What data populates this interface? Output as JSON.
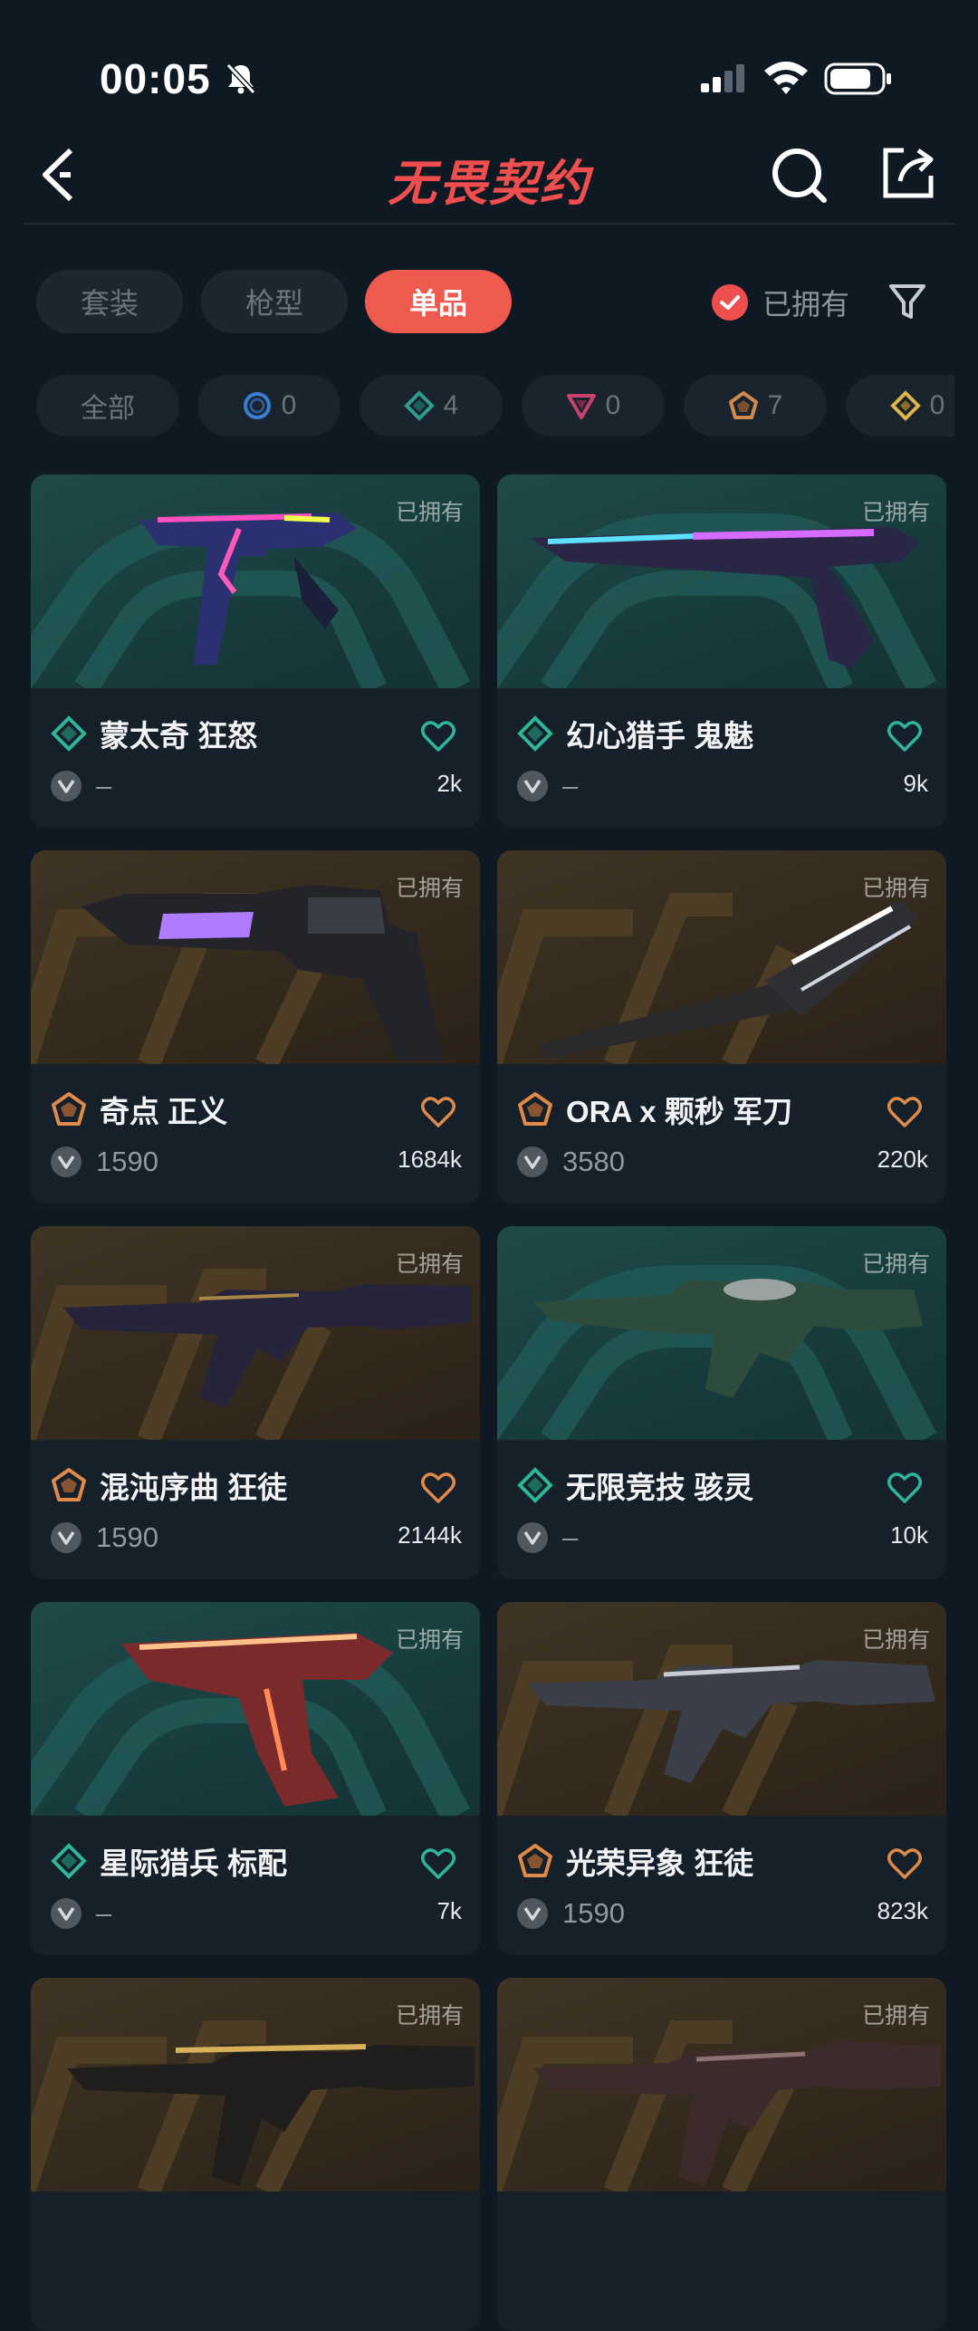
{
  "status": {
    "time": "00:05"
  },
  "header": {
    "title": "无畏契约"
  },
  "tabs": [
    {
      "label": "套装",
      "active": false
    },
    {
      "label": "枪型",
      "active": false
    },
    {
      "label": "单品",
      "active": true
    }
  ],
  "owned_filter": {
    "label": "已拥有",
    "checked": true
  },
  "tiers": [
    {
      "label": "全部",
      "icon": "none"
    },
    {
      "label": "0",
      "icon": "select-tier-icon",
      "color": "#3b7fd1"
    },
    {
      "label": "4",
      "icon": "deluxe-tier-icon",
      "color": "#2f9c8a"
    },
    {
      "label": "0",
      "icon": "premium-tier-icon",
      "color": "#c8426e"
    },
    {
      "label": "7",
      "icon": "exclusive-tier-icon",
      "color": "#d08a4c"
    },
    {
      "label": "0",
      "icon": "ultra-tier-icon",
      "color": "#e0b54a"
    }
  ],
  "colors": {
    "accent": "#ef5a4e",
    "teal": "#2fb59a",
    "gold": "#e08a4a"
  },
  "items": [
    {
      "name": "蒙太奇 狂怒",
      "owned": "已拥有",
      "price": "–",
      "likes": "2k",
      "tier": "deluxe",
      "bg": "teal",
      "heart": "#2fb59a",
      "gun": "pistol-neon"
    },
    {
      "name": "幻心猎手 鬼魅",
      "owned": "已拥有",
      "price": "–",
      "likes": "9k",
      "tier": "deluxe",
      "bg": "teal",
      "heart": "#2fb59a",
      "gun": "pistol-long"
    },
    {
      "name": "奇点 正义",
      "owned": "已拥有",
      "price": "1590",
      "likes": "1684k",
      "tier": "exclusive",
      "bg": "gold",
      "heart": "#e08a4a",
      "gun": "revolver"
    },
    {
      "name": "ORA x 颗秒 军刀",
      "owned": "已拥有",
      "price": "3580",
      "likes": "220k",
      "tier": "exclusive",
      "bg": "gold",
      "heart": "#e08a4a",
      "gun": "knife"
    },
    {
      "name": "混沌序曲 狂徒",
      "owned": "已拥有",
      "price": "1590",
      "likes": "2144k",
      "tier": "exclusive",
      "bg": "gold",
      "heart": "#e08a4a",
      "gun": "rifle-dark"
    },
    {
      "name": "无限竞技 骇灵",
      "owned": "已拥有",
      "price": "–",
      "likes": "10k",
      "tier": "deluxe",
      "bg": "teal",
      "heart": "#2fb59a",
      "gun": "smg-green"
    },
    {
      "name": "星际猎兵 标配",
      "owned": "已拥有",
      "price": "–",
      "likes": "7k",
      "tier": "deluxe",
      "bg": "teal",
      "heart": "#2fb59a",
      "gun": "pistol-red"
    },
    {
      "name": "光荣异象 狂徒",
      "owned": "已拥有",
      "price": "1590",
      "likes": "823k",
      "tier": "exclusive",
      "bg": "gold",
      "heart": "#e08a4a",
      "gun": "rifle-silver"
    },
    {
      "name": "",
      "owned": "已拥有",
      "price": "",
      "likes": "",
      "tier": "exclusive",
      "bg": "gold",
      "heart": "#e08a4a",
      "gun": "rifle-gold"
    },
    {
      "name": "",
      "owned": "已拥有",
      "price": "",
      "likes": "",
      "tier": "exclusive",
      "bg": "gold",
      "heart": "#e08a4a",
      "gun": "rifle-bone"
    }
  ]
}
